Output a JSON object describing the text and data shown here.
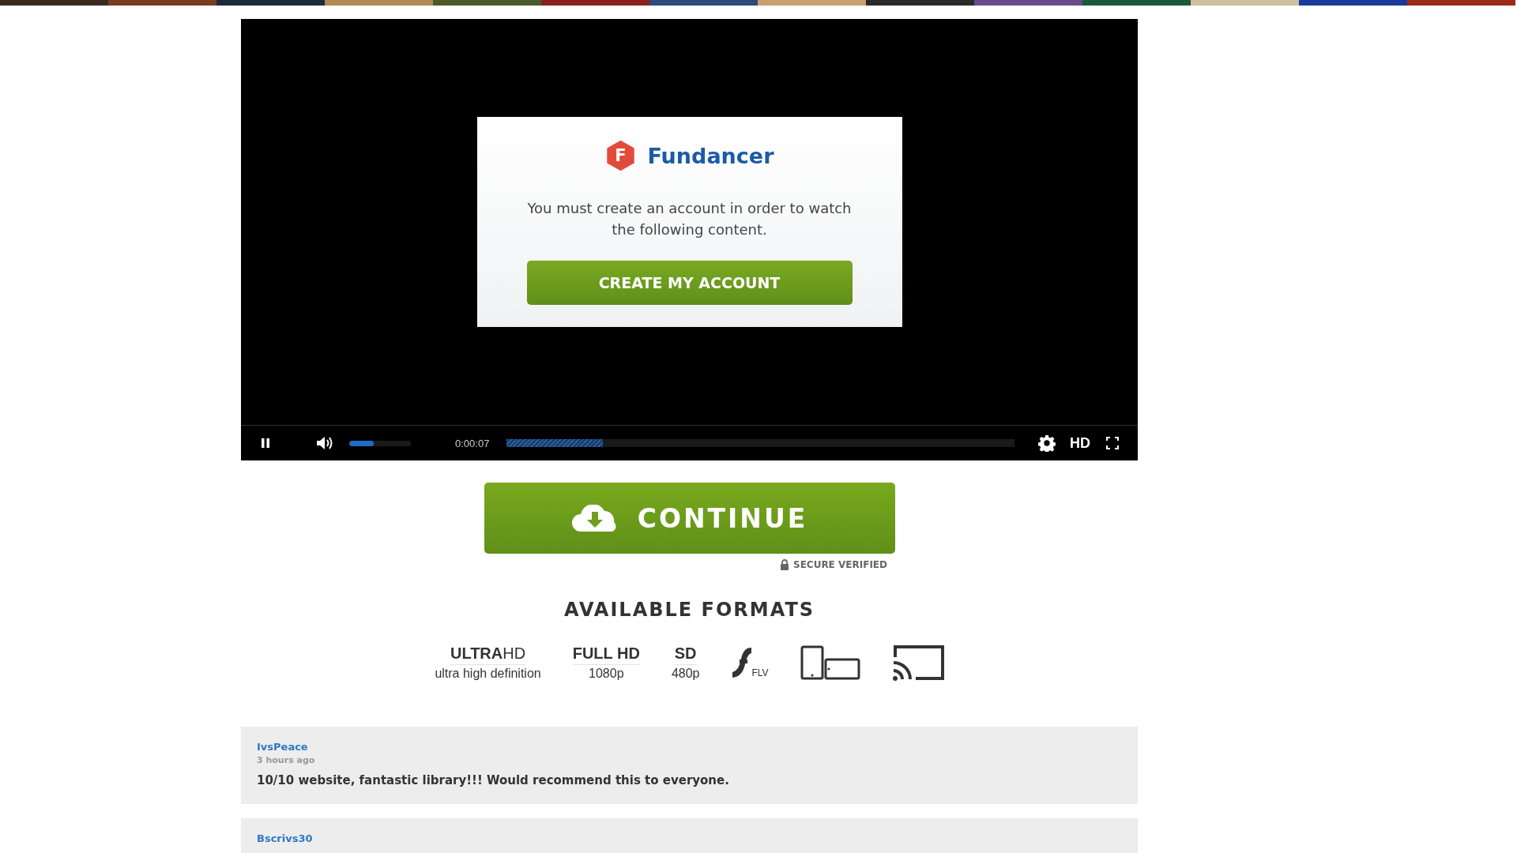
{
  "player": {
    "playing": true,
    "volume": {
      "level": 0.4
    },
    "time": "0:00:07",
    "progress": {
      "level": 0.19
    },
    "quality": "HD"
  },
  "modal": {
    "logo_letter": "F",
    "brand": "Fundancer",
    "message": "You must create an account in order to watch the following content.",
    "button": "CREATE MY ACCOUNT"
  },
  "continue_button": "CONTINUE",
  "secure_note": "SECURE VERIFIED",
  "formats": {
    "title": "AVAILABLE FORMATS",
    "items": [
      {
        "kind": "text",
        "name": "**ULTRA**HD",
        "detail": "ultra high definition"
      },
      {
        "kind": "text",
        "name": "FULL HD",
        "detail": "1080p"
      },
      {
        "kind": "text",
        "name": "SD",
        "detail": "480p"
      },
      {
        "kind": "flash",
        "name": "FLV"
      },
      {
        "kind": "devices"
      },
      {
        "kind": "cast"
      }
    ]
  },
  "comments": [
    {
      "author": "IvsPeace",
      "time": "3 hours ago",
      "text": "10/10 website, fantastic library!!! Would recommend this to everyone."
    },
    {
      "author": "Bscrivs30"
    }
  ]
}
